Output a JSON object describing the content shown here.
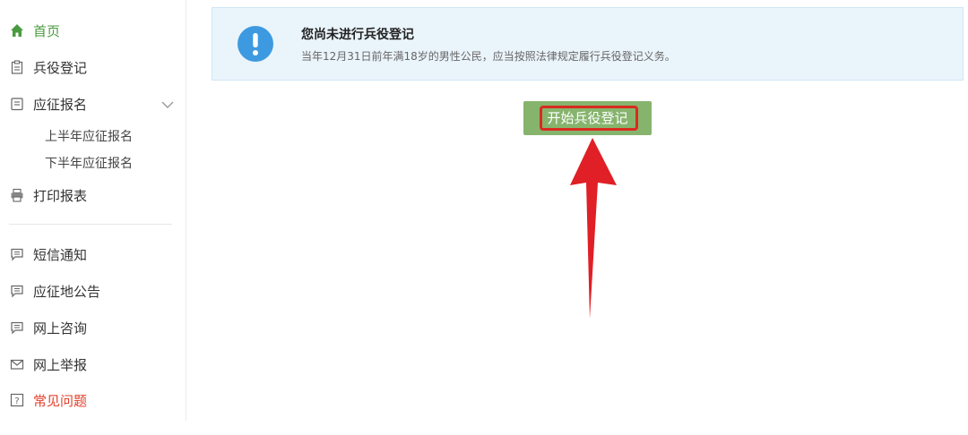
{
  "sidebar": {
    "items": [
      {
        "label": "首页",
        "icon": "home-icon"
      },
      {
        "label": "兵役登记",
        "icon": "clipboard-icon"
      },
      {
        "label": "应征报名",
        "icon": "form-icon"
      },
      {
        "label": "打印报表",
        "icon": "printer-icon"
      },
      {
        "label": "短信通知",
        "icon": "message-icon"
      },
      {
        "label": "应征地公告",
        "icon": "message-icon"
      },
      {
        "label": "网上咨询",
        "icon": "message-icon"
      },
      {
        "label": "网上举报",
        "icon": "mail-icon"
      },
      {
        "label": "常见问题",
        "icon": "question-icon"
      }
    ],
    "sub_items": [
      {
        "label": "上半年应征报名"
      },
      {
        "label": "下半年应征报名"
      }
    ]
  },
  "notice": {
    "title": "您尚未进行兵役登记",
    "description": "当年12月31日前年满18岁的男性公民，应当按照法律规定履行兵役登记义务。",
    "icon": "exclamation-icon"
  },
  "main": {
    "start_button_label": "开始兵役登记"
  },
  "colors": {
    "active_green": "#4a9a3f",
    "highlight_red": "#e2402c",
    "button_green": "#86b46d",
    "notice_bg": "#eaf4fb",
    "notice_icon_blue": "#3d9ae0",
    "annotation_red": "#e01f26"
  }
}
